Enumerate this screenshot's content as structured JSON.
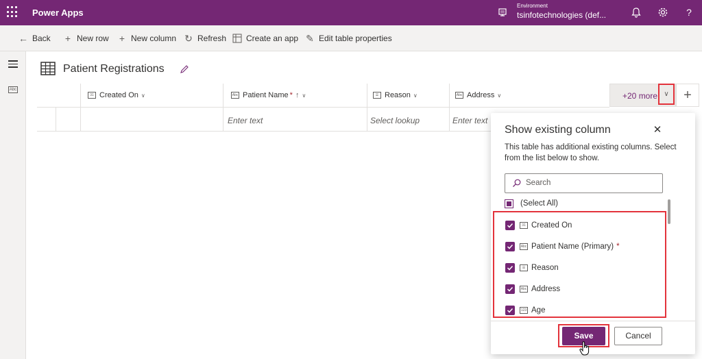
{
  "app": {
    "name": "Power Apps"
  },
  "environment": {
    "label": "Environment",
    "value": "tsinfotechnologies (def..."
  },
  "commands": {
    "back": "Back",
    "new_row": "New row",
    "new_column": "New column",
    "refresh": "Refresh",
    "create_app": "Create an app",
    "edit_table": "Edit table properties"
  },
  "page": {
    "title": "Patient Registrations"
  },
  "grid": {
    "columns": [
      "Created On",
      "Patient Name",
      "Reason",
      "Address"
    ],
    "required_marker": "*",
    "placeholders": [
      "Enter text",
      "Select lookup",
      "Enter text"
    ],
    "more_label": "+20 more"
  },
  "panel": {
    "title": "Show existing column",
    "desc": "This table has additional existing columns. Select from the list below to show.",
    "search_placeholder": "Search",
    "select_all": "(Select All)",
    "items": [
      {
        "label": "Created On",
        "type_icon": "date-icon",
        "required": false
      },
      {
        "label": "Patient Name (Primary)",
        "type_icon": "text-icon",
        "required": true
      },
      {
        "label": "Reason",
        "type_icon": "lookup-list-icon",
        "required": false
      },
      {
        "label": "Address",
        "type_icon": "text-icon",
        "required": false
      },
      {
        "label": "Age",
        "type_icon": "number-icon",
        "required": false
      }
    ],
    "save": "Save",
    "cancel": "Cancel"
  },
  "colors": {
    "brand": "#742774",
    "highlight": "#e3323b"
  }
}
